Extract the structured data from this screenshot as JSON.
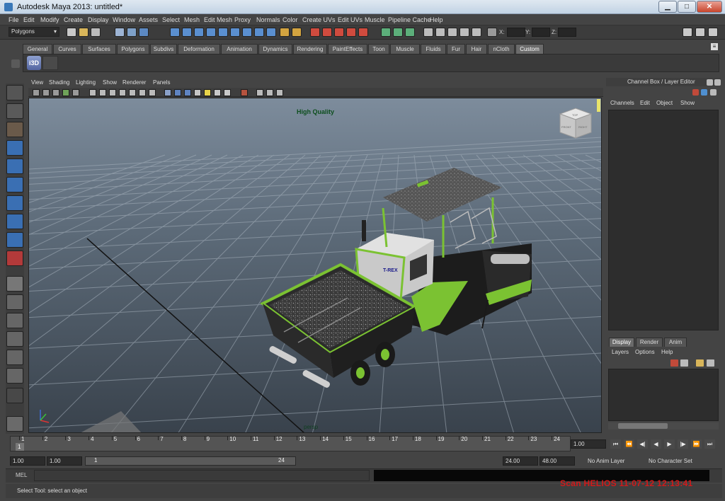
{
  "window": {
    "title": "Autodesk Maya 2013: untitled*",
    "controls": {
      "minimize": "▁",
      "maximize": "□",
      "close": "✕"
    }
  },
  "menubar": [
    "File",
    "Edit",
    "Modify",
    "Create",
    "Display",
    "Window",
    "Assets",
    "Select",
    "Mesh",
    "Edit Mesh",
    "Proxy",
    "Normals",
    "Color",
    "Create UVs",
    "Edit UVs",
    "Muscle",
    "Pipeline Cache",
    "Help"
  ],
  "status_line": {
    "mode_menu": "Polygons",
    "xyz": {
      "x": "X:",
      "y": "Y:",
      "z": "Z:"
    }
  },
  "shelf": {
    "tabs": [
      "General",
      "Curves",
      "Surfaces",
      "Polygons",
      "Subdivs",
      "Deformation",
      "Animation",
      "Dynamics",
      "Rendering",
      "PaintEffects",
      "Toon",
      "Muscle",
      "Fluids",
      "Fur",
      "Hair",
      "nCloth",
      "Custom"
    ],
    "active_tab": "Custom",
    "icon_label": "i3D"
  },
  "panel": {
    "menu": [
      "View",
      "Shading",
      "Lighting",
      "Show",
      "Renderer",
      "Panels"
    ],
    "hud_quality": "High Quality",
    "camera_label": "persp",
    "viewcube_faces": {
      "top": "TOP",
      "front": "FRONT",
      "right": "RIGHT"
    },
    "model_badge": "T-REX"
  },
  "channel_box": {
    "title": "Channel Box / Layer Editor",
    "menu": [
      "Channels",
      "Edit",
      "Object",
      "Show"
    ]
  },
  "layer_editor": {
    "tabs": [
      "Display",
      "Render",
      "Anim"
    ],
    "active_tab": "Display",
    "menu": [
      "Layers",
      "Options",
      "Help"
    ]
  },
  "time_slider": {
    "ticks": [
      "1",
      "2",
      "3",
      "4",
      "5",
      "6",
      "7",
      "8",
      "9",
      "10",
      "11",
      "12",
      "13",
      "14",
      "15",
      "16",
      "17",
      "18",
      "19",
      "20",
      "21",
      "22",
      "23",
      "24"
    ],
    "current_frame": "1",
    "current_time_field": "1.00"
  },
  "range_slider": {
    "start_time": "1.00",
    "playback_start": "1.00",
    "range_start_label": "1",
    "range_end_label": "24",
    "playback_end": "24.00",
    "end_time": "48.00",
    "anim_layer": "No Anim Layer",
    "character_set": "No Character Set"
  },
  "playback_buttons": [
    "⏮",
    "⏪",
    "◀|",
    "◀",
    "▶",
    "|▶",
    "⏩",
    "⏭"
  ],
  "command_line": {
    "label": "MEL"
  },
  "help_line": {
    "text": "Select Tool: select an object"
  },
  "watermark": "Scan HELIOS 11-07-12 12:13:41",
  "colors": {
    "ui_bg": "#444444",
    "shelf_active": "#6b6b6b",
    "model_green": "#7bc232",
    "watermark": "#d11a1a"
  }
}
